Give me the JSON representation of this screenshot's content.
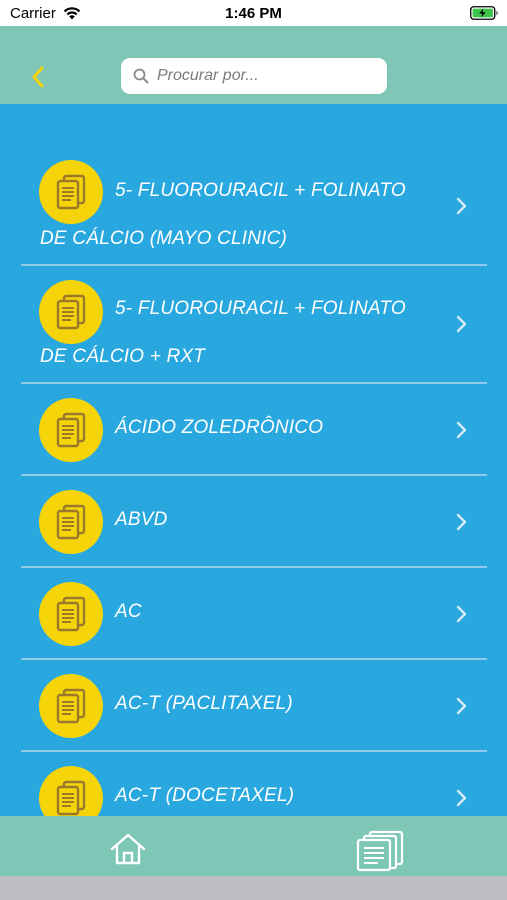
{
  "status_bar": {
    "carrier": "Carrier",
    "time": "1:46 PM"
  },
  "search": {
    "placeholder": "Procurar por..."
  },
  "protocols": [
    {
      "line1": "5- FLUOROURACIL + FOLINATO",
      "line2": "DE CÁLCIO (MAYO CLINIC)"
    },
    {
      "line1": "5- FLUOROURACIL + FOLINATO",
      "line2": "DE CÁLCIO + RXT"
    },
    {
      "line1": "ÁCIDO ZOLEDRÔNICO"
    },
    {
      "line1": "ABVD"
    },
    {
      "line1": "AC"
    },
    {
      "line1": "AC-T (PACLITAXEL)"
    },
    {
      "line1": "AC-T (DOCETAXEL)"
    }
  ],
  "colors": {
    "header": "#7ec6b6",
    "list_background": "#29a8e0",
    "icon_circle": "#f6d40a",
    "back_chevron": "#f6d40a"
  },
  "icons": {
    "back": "chevron-left-icon",
    "search": "magnifier-icon",
    "item": "documents-icon",
    "tab_home": "home-icon",
    "tab_protocols": "documents-icon"
  }
}
